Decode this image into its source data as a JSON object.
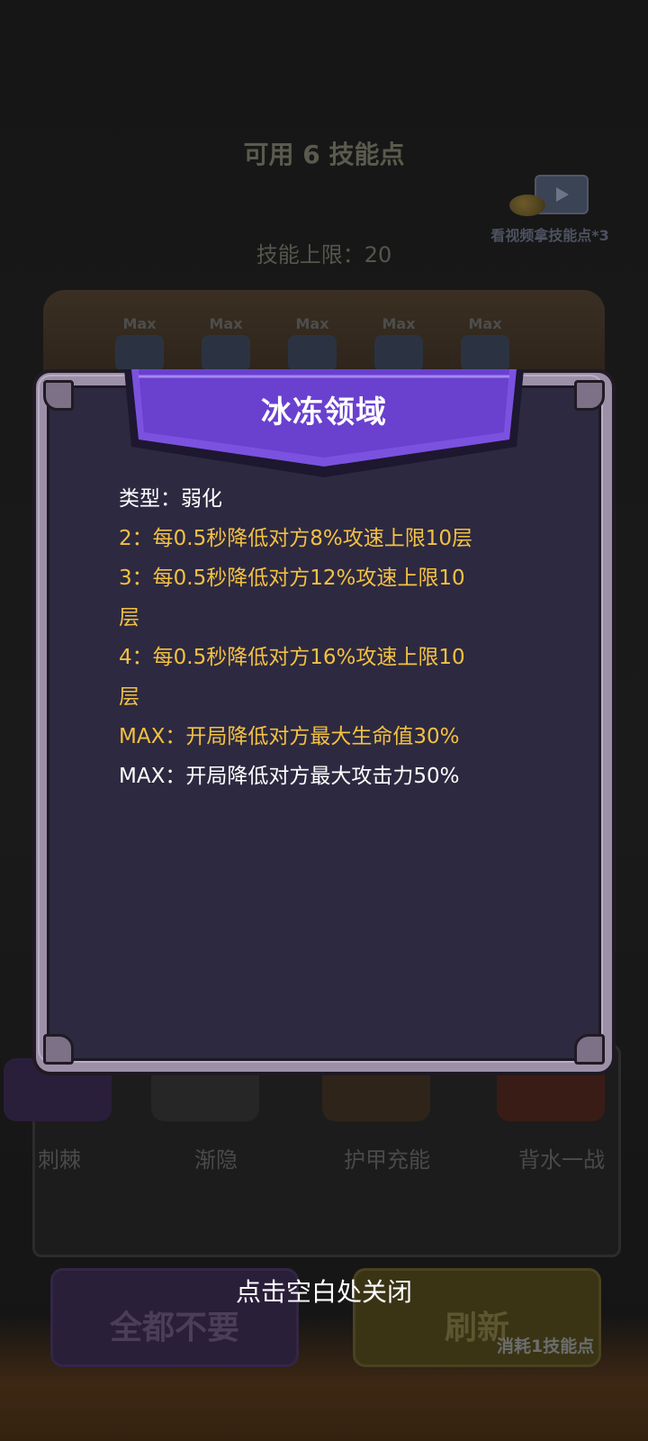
{
  "background": {
    "skill_points": "可用 6 技能点",
    "skill_limit": "技能上限：20",
    "video_reward_label": "看视频拿技能点*3",
    "slot_badges": [
      "Max",
      "Max",
      "Max",
      "Max",
      "Max"
    ],
    "skill_cards": [
      "刺棘",
      "渐隐",
      "护甲充能",
      "背水一战"
    ],
    "discard_all_button": "全都不要",
    "refresh_button": "刷新",
    "refresh_cost": "消耗1技能点"
  },
  "dialog": {
    "title": "冰冻领域",
    "lines": [
      {
        "text": "类型：弱化",
        "color": "#ffffff"
      },
      {
        "text": "2：每0.5秒降低对方8%攻速上限10层",
        "color": "#f3c142"
      },
      {
        "text": "3：每0.5秒降低对方12%攻速上限10",
        "color": "#f3c142"
      },
      {
        "text": "层",
        "color": "#f3c142"
      },
      {
        "text": "4：每0.5秒降低对方16%攻速上限10",
        "color": "#f3c142"
      },
      {
        "text": "层",
        "color": "#f3c142"
      },
      {
        "text": "MAX：开局降低对方最大生命值30%",
        "color": "#f3c142"
      },
      {
        "text": "MAX：开局降低对方最大攻击力50%",
        "color": "#ffffff"
      }
    ]
  },
  "close_hint": "点击空白处关闭",
  "colors": {
    "ribbon": "#6f45d2",
    "panel": "#2d2940",
    "gold_text": "#f3c142"
  }
}
